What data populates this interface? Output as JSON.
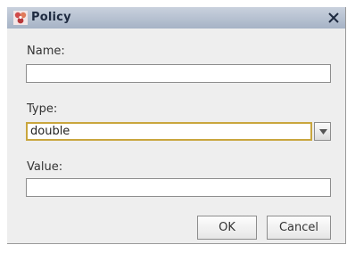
{
  "window": {
    "title": "Policy",
    "close_glyph": "✕"
  },
  "form": {
    "name": {
      "label": "Name:",
      "value": ""
    },
    "type": {
      "label": "Type:",
      "selected": "double"
    },
    "value": {
      "label": "Value:",
      "value": ""
    }
  },
  "buttons": {
    "ok_label": "OK",
    "cancel_label": "Cancel"
  },
  "colors": {
    "titlebar": "#a6b3c6",
    "focus_border": "#c9a63e",
    "window_bg": "#eeeeee"
  },
  "icons": {
    "title": "policy-app-icon",
    "close": "close-icon",
    "dropdown": "chevron-down-icon"
  }
}
